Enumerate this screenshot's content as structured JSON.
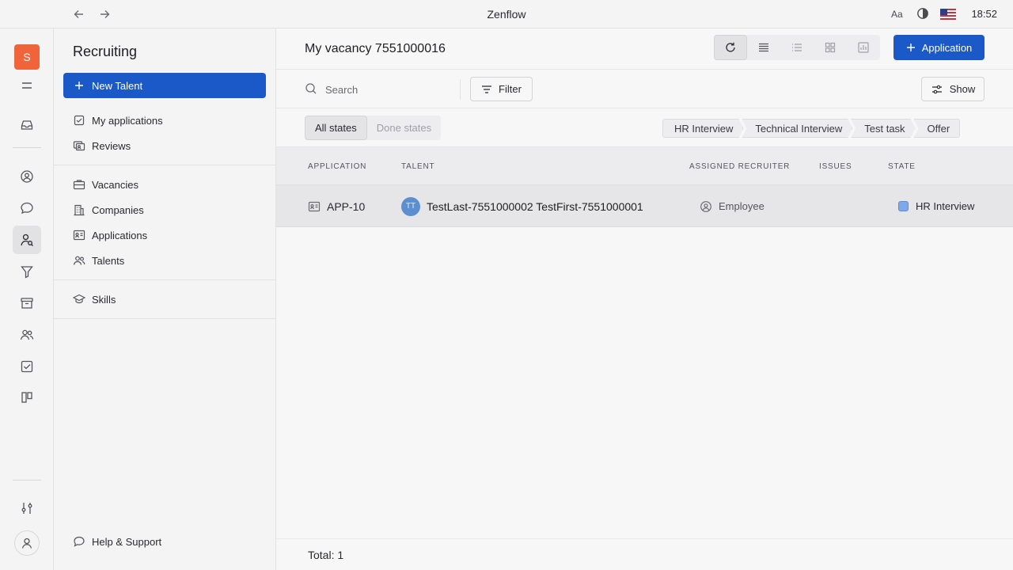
{
  "window": {
    "title": "Zenflow",
    "time": "18:52",
    "font_button": "Aa"
  },
  "rail": {
    "workspace_letter": "S"
  },
  "navigator": {
    "title": "Recruiting",
    "new_talent_label": "New Talent",
    "group1": [
      {
        "label": "My applications",
        "icon": "checkbox-icon"
      },
      {
        "label": "Reviews",
        "icon": "reviews-icon"
      }
    ],
    "group2": [
      {
        "label": "Vacancies",
        "icon": "briefcase-icon"
      },
      {
        "label": "Companies",
        "icon": "building-icon"
      },
      {
        "label": "Applications",
        "icon": "id-card-icon"
      },
      {
        "label": "Talents",
        "icon": "people-icon"
      }
    ],
    "group3": [
      {
        "label": "Skills",
        "icon": "graduation-cap-icon"
      }
    ],
    "help_label": "Help & Support"
  },
  "main": {
    "title": "My vacancy 7551000016",
    "application_button": "Application",
    "search_placeholder": "Search",
    "filter_label": "Filter",
    "show_label": "Show",
    "state_tabs": [
      "All states",
      "Done states"
    ],
    "stages": [
      "HR Interview",
      "Technical Interview",
      "Test task",
      "Offer"
    ],
    "columns": [
      "APPLICATION",
      "TALENT",
      "ASSIGNED RECRUITER",
      "ISSUES",
      "STATE"
    ],
    "rows": [
      {
        "application": "APP-10",
        "talent_initials": "TT",
        "talent": "TestLast-7551000002 TestFirst-7551000001",
        "recruiter": "Employee",
        "issues": "",
        "state": "HR Interview"
      }
    ],
    "total": "Total: 1"
  },
  "colors": {
    "accent": "#1b58c8",
    "workspace": "#f0643c",
    "state_hr_interview": "#7fa8ea",
    "avatar": "#5b8fd0"
  }
}
